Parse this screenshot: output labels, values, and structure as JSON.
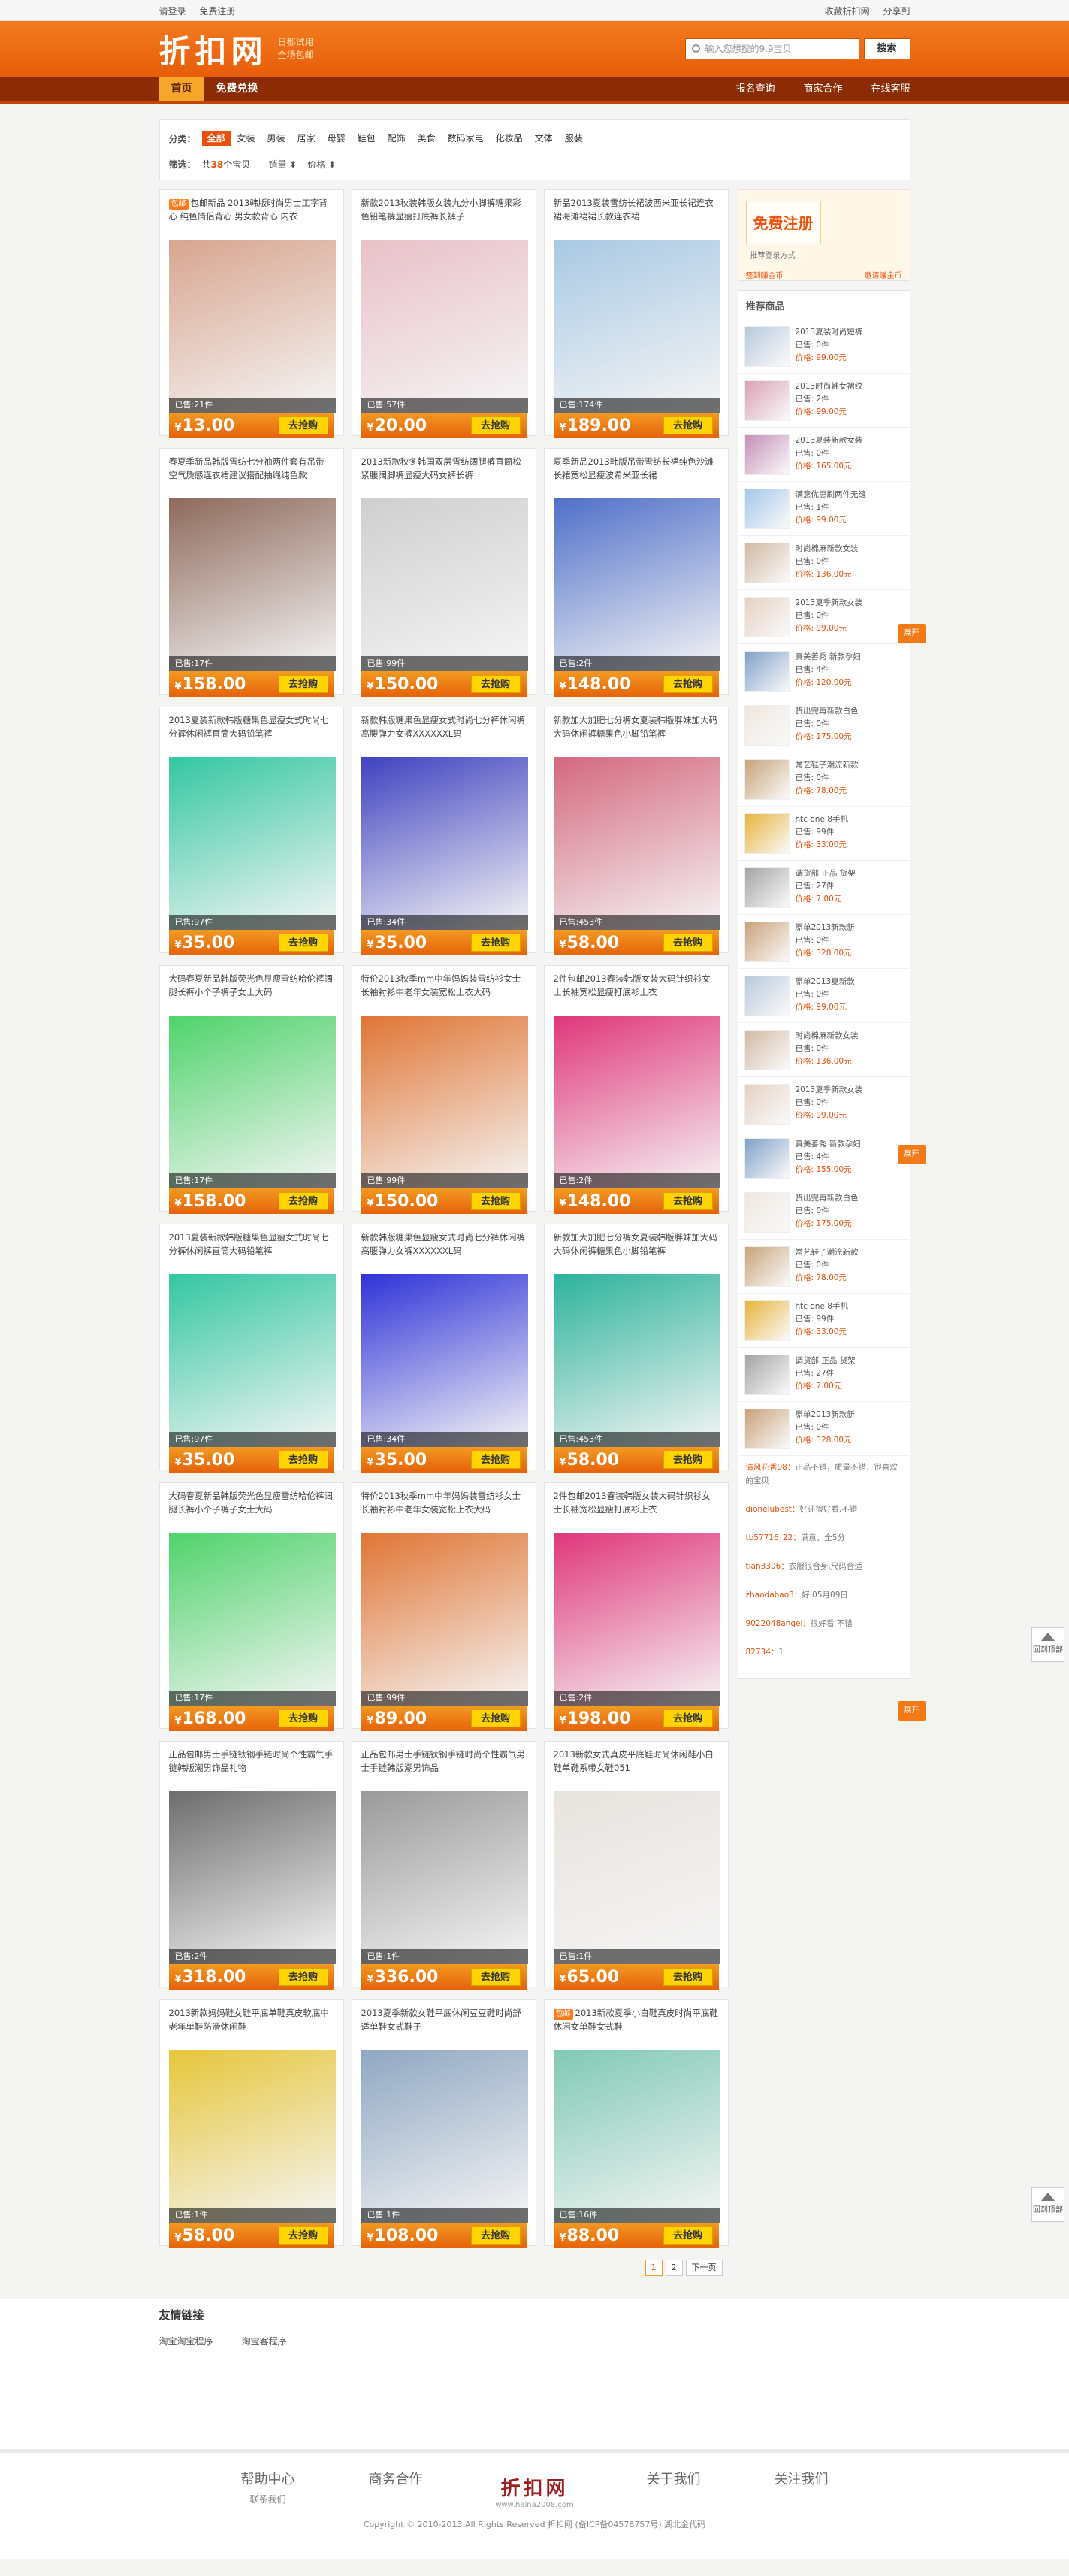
{
  "topbar": {
    "login": "请登录",
    "register": "免费注册",
    "fav": "收藏折扣网",
    "share": "分享到"
  },
  "header": {
    "logo": "折扣网",
    "slogan1": "日都试用",
    "slogan2": "全场包邮",
    "search_placeholder": "输入您想搜的9.9宝贝",
    "search_btn": "搜索"
  },
  "nav": {
    "items": [
      "首页",
      "免费兑换"
    ],
    "right": [
      "报名查询",
      "商家合作",
      "在线客服"
    ]
  },
  "filter": {
    "cat_label": "分类：",
    "cats": [
      "全部",
      "女装",
      "男装",
      "居家",
      "母婴",
      "鞋包",
      "配饰",
      "美食",
      "数码家电",
      "化妆品",
      "文体",
      "服装"
    ],
    "sel_label": "筛选：",
    "count_prefix": "共",
    "count": "38",
    "count_suffix": "个宝贝",
    "sort1": "销量",
    "sort2": "价格"
  },
  "products": [
    {
      "title": "包邮新品 2013韩版时尚男士工字背心 纯色情侣背心 男女款背心 内衣",
      "price": "13.00",
      "sold": "已售:21件",
      "tag": "包邮",
      "color": "#d8a58f"
    },
    {
      "title": "新款2013秋装韩版女装九分小脚裤糖果彩色铅笔裤显瘦打底裤长裤子",
      "price": "20.00",
      "sold": "已售:57件",
      "tag": "",
      "color": "#e9c1c8"
    },
    {
      "title": "新品2013夏装雪纺长裙波西米亚长裙连衣裙海滩裙裙长款连衣裙",
      "price": "189.00",
      "sold": "已售:174件",
      "tag": "",
      "color": "#a9c9e4"
    },
    {
      "title": "春夏季新品韩版雪纺七分袖两件套有吊带 空气质感连衣裙建议搭配抽绳纯色款",
      "price": "158.00",
      "sold": "已售:17件",
      "tag": "",
      "color": "#8e6a5c"
    },
    {
      "title": "2013新款秋冬韩国双层雪纺阔腿裤直筒松紧腰阔脚裤显瘦大码女裤长裤",
      "price": "150.00",
      "sold": "已售:99件",
      "tag": "",
      "color": "#cfcfcf"
    },
    {
      "title": "夏季新品2013韩版吊带雪纺长裙纯色沙滩长裙宽松显瘦波希米亚长裙",
      "price": "148.00",
      "sold": "已售:2件",
      "tag": "",
      "color": "#4f6fc9"
    },
    {
      "title": "2013夏装新款韩版糖果色显瘦女式时尚七分裤休闲裤直筒大码铅笔裤",
      "price": "35.00",
      "sold": "已售:97件",
      "tag": "",
      "color": "#33c7a1"
    },
    {
      "title": "新款韩版糖果色显瘦女式时尚七分裤休闲裤高腰弹力女裤XXXXXXL码",
      "price": "35.00",
      "sold": "已售:34件",
      "tag": "",
      "color": "#3f42c0"
    },
    {
      "title": "新款加大加肥七分裤女夏装韩版胖妹加大码大码休闲裤糖果色小脚铅笔裤",
      "price": "58.00",
      "sold": "已售:453件",
      "tag": "",
      "color": "#d4687e"
    },
    {
      "title": "大码春夏新品韩版荧光色显瘦雪纺哈伦裤阔腿长裤小个子裤子女士大码",
      "price": "158.00",
      "sold": "已售:17件",
      "tag": "",
      "color": "#4fd36b"
    },
    {
      "title": "特价2013秋季mm中年妈妈装雪纺衫女士长袖衬衫中老年女装宽松上衣大码",
      "price": "150.00",
      "sold": "已售:99件",
      "tag": "",
      "color": "#e07534"
    },
    {
      "title": "2件包邮2013春装韩版女装大码针织衫女士长袖宽松显瘦打底衫上衣",
      "price": "148.00",
      "sold": "已售:2件",
      "tag": "",
      "color": "#e0367a"
    },
    {
      "title": "2013夏装新款韩版糖果色显瘦女式时尚七分裤休闲裤直筒大码铅笔裤",
      "price": "35.00",
      "sold": "已售:97件",
      "tag": "",
      "color": "#33c7a1"
    },
    {
      "title": "新款韩版糖果色显瘦女式时尚七分裤休闲裤高腰弹力女裤XXXXXXL码",
      "price": "35.00",
      "sold": "已售:34件",
      "tag": "",
      "color": "#2f33d8"
    },
    {
      "title": "新款加大加肥七分裤女夏装韩版胖妹加大码大码休闲裤糖果色小脚铅笔裤",
      "price": "58.00",
      "sold": "已售:453件",
      "tag": "",
      "color": "#2cb39b"
    },
    {
      "title": "大码春夏新品韩版荧光色显瘦雪纺哈伦裤阔腿长裤小个子裤子女士大码",
      "price": "168.00",
      "sold": "已售:17件",
      "tag": "",
      "color": "#4fd36b"
    },
    {
      "title": "特价2013秋季mm中年妈妈装雪纺衫女士长袖衬衫中老年女装宽松上衣大码",
      "price": "89.00",
      "sold": "已售:99件",
      "tag": "",
      "color": "#e07534"
    },
    {
      "title": "2件包邮2013春装韩版女装大码针织衫女士长袖宽松显瘦打底衫上衣",
      "price": "198.00",
      "sold": "已售:2件",
      "tag": "",
      "color": "#e0367a"
    },
    {
      "title": "正品包邮男士手链钛钢手链时尚个性霸气手链韩版潮男饰品礼物",
      "price": "318.00",
      "sold": "已售:2件",
      "tag": "",
      "color": "#6d6d6d"
    },
    {
      "title": "正品包邮男士手链钛钢手链时尚个性霸气男士手链韩版潮男饰品",
      "price": "336.00",
      "sold": "已售:1件",
      "tag": "",
      "color": "#9a9a9a"
    },
    {
      "title": "2013新款女式真皮平底鞋时尚休闲鞋小白鞋单鞋系带女鞋051",
      "price": "65.00",
      "sold": "已售:1件",
      "tag": "",
      "color": "#e8e3de"
    },
    {
      "title": "2013新款妈妈鞋女鞋平底单鞋真皮软底中老年单鞋防滑休闲鞋",
      "price": "58.00",
      "sold": "已售:1件",
      "tag": "",
      "color": "#e6c63a"
    },
    {
      "title": "2013夏季新款女鞋平底休闲豆豆鞋时尚舒适单鞋女式鞋子",
      "price": "108.00",
      "sold": "已售:1件",
      "tag": "",
      "color": "#8fa7c2"
    },
    {
      "title": "2013新款夏季小白鞋真皮时尚平底鞋休闲女单鞋女式鞋",
      "price": "88.00",
      "sold": "已售:16件",
      "tag": "包邮",
      "color": "#80c9b5"
    }
  ],
  "buy_label": "去抢购",
  "currency": "¥",
  "pagination": [
    "1",
    "2",
    "下一页"
  ],
  "sidebar": {
    "reg_btn": "免费注册",
    "reg_side": "推荐登录方式",
    "reg_link1": "签到赚金币",
    "reg_link2": "邀请赚金币",
    "rec_title": "推荐商品",
    "recs": [
      {
        "name": "2013夏装时尚短裤",
        "sold": "已售: 0件",
        "price": "价格: 99.00元",
        "color": "#b8c9dc"
      },
      {
        "name": "2013时尚韩女裙纹",
        "sold": "已售: 2件",
        "price": "价格: 99.00元",
        "color": "#d9a1b2"
      },
      {
        "name": "2013夏装新款女装",
        "sold": "已售: 0件",
        "price": "价格: 165.00元",
        "color": "#c48fb7"
      },
      {
        "name": "满意优惠刷两件无缝",
        "sold": "已售: 1件",
        "price": "价格: 99.00元",
        "color": "#a3c7e8"
      },
      {
        "name": "时尚棉麻新款女装",
        "sold": "已售: 0件",
        "price": "价格: 136.00元",
        "color": "#d2b9a4"
      },
      {
        "name": "2013夏季新款女装",
        "sold": "已售: 0件",
        "price": "价格: 99.00元",
        "color": "#e5d1c2"
      },
      {
        "name": "真美善秀 新款孕妇",
        "sold": "已售: 4件",
        "price": "价格: 120.00元",
        "color": "#7fa0c8"
      },
      {
        "name": "货出完再新款白色",
        "sold": "已售: 0件",
        "price": "价格: 175.00元",
        "color": "#eee6dd"
      },
      {
        "name": "常艺鞋子潮流新款",
        "sold": "已售: 0件",
        "price": "价格: 78.00元",
        "color": "#c8a37a"
      },
      {
        "name": "htc one 8手机",
        "sold": "已售: 99件",
        "price": "价格: 33.00元",
        "color": "#e7b33c"
      },
      {
        "name": "调货部 正品 货架",
        "sold": "已售: 27件",
        "price": "价格: 7.00元",
        "color": "#a4a4a4"
      },
      {
        "name": "原单2013新款新",
        "sold": "已售: 0件",
        "price": "价格: 328.00元",
        "color": "#c9a27a"
      },
      {
        "name": "原单2013夏新款",
        "sold": "已售: 0件",
        "price": "价格: 99.00元",
        "color": "#b8c9dc"
      },
      {
        "name": "时尚棉麻新款女装",
        "sold": "已售: 0件",
        "price": "价格: 136.00元",
        "color": "#d2b9a4"
      },
      {
        "name": "2013夏季新款女装",
        "sold": "已售: 0件",
        "price": "价格: 99.00元",
        "color": "#e5d1c2"
      },
      {
        "name": "真美善秀 新款孕妇",
        "sold": "已售: 4件",
        "price": "价格: 155.00元",
        "color": "#7fa0c8"
      },
      {
        "name": "货出完再新款白色",
        "sold": "已售: 0件",
        "price": "价格: 175.00元",
        "color": "#eee6dd"
      },
      {
        "name": "常艺鞋子潮流新款",
        "sold": "已售: 0件",
        "price": "价格: 78.00元",
        "color": "#c8a37a"
      },
      {
        "name": "htc one 8手机",
        "sold": "已售: 99件",
        "price": "价格: 33.00元",
        "color": "#e7b33c"
      },
      {
        "name": "调货部 正品 货架",
        "sold": "已售: 27件",
        "price": "价格: 7.00元",
        "color": "#a4a4a4"
      },
      {
        "name": "原单2013新款新",
        "sold": "已售: 0件",
        "price": "价格: 328.00元",
        "color": "#c9a27a"
      }
    ],
    "comments": [
      {
        "user": "清风花香98：",
        "text": "正品不错，质量不错，很喜欢的宝贝"
      },
      {
        "user": "dionelubest：",
        "text": "好评很好看,不错"
      },
      {
        "user": "tb57716_22：",
        "text": "满意，全5分"
      },
      {
        "user": "tian3306：",
        "text": "衣服很合身,尺码合适"
      },
      {
        "user": "zhaodabao3：",
        "text": "好 05月09日"
      },
      {
        "user": "9022048angel：",
        "text": "很好看 不错"
      },
      {
        "user": "82734：",
        "text": "1"
      }
    ]
  },
  "float_tab": "展开",
  "backtop": "回到顶部",
  "links": {
    "title": "友情链接",
    "items": [
      "淘宝淘宝程序",
      "淘宝客程序"
    ]
  },
  "footer": {
    "col1": "帮助中心",
    "col1_sub": "联系我们",
    "col2": "商务合作",
    "logo": "折扣网",
    "logo_sub": "www.haina2008.com",
    "col3": "关于我们",
    "col4": "关注我们",
    "copyright": "Copyright © 2010-2013 All Rights Reserved 折扣网 (备ICP备04578757号) 湖北金代码"
  }
}
